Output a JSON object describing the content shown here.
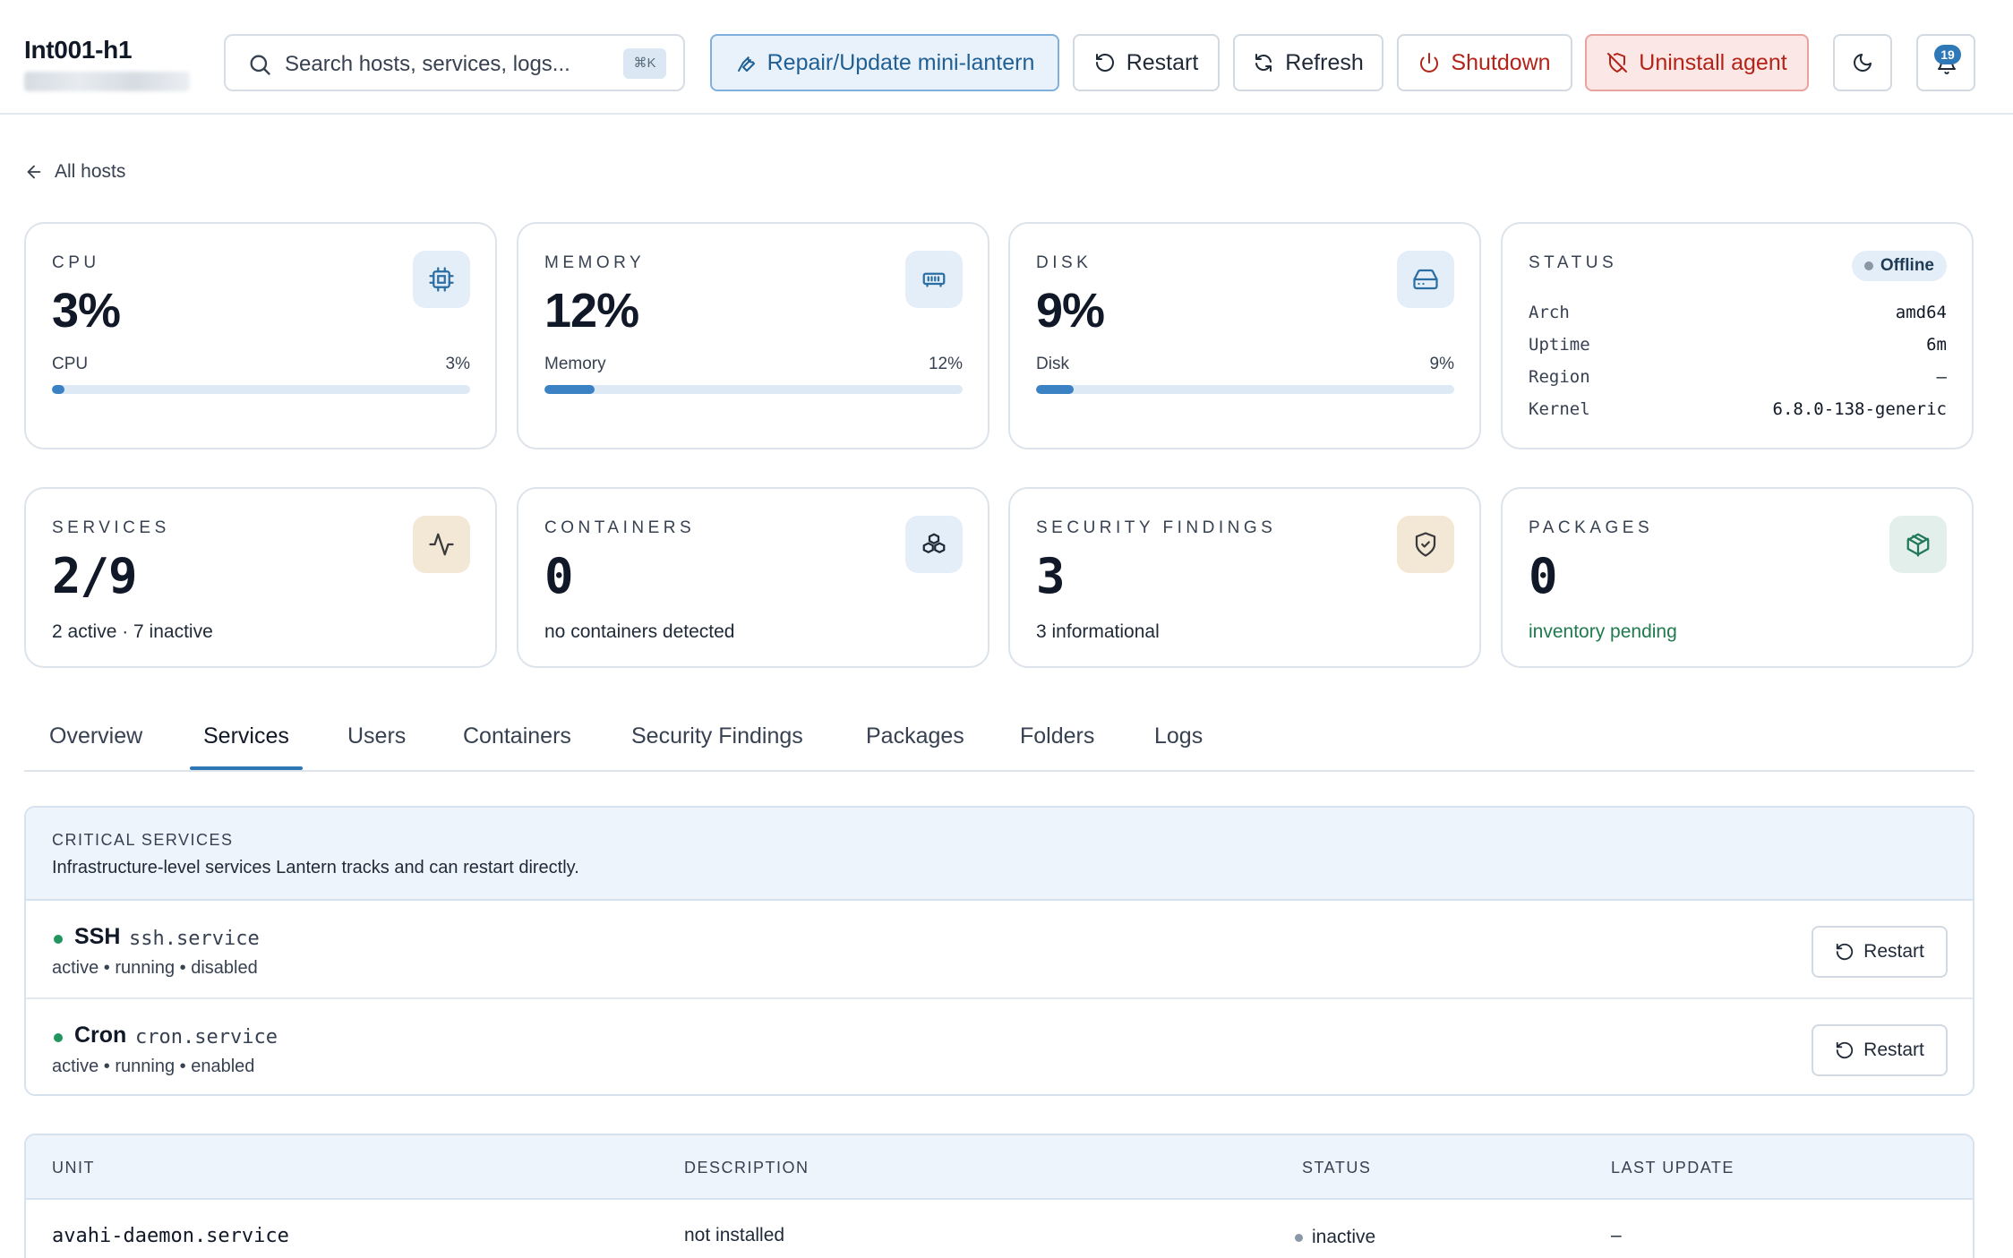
{
  "header": {
    "host_name": "Int001-h1",
    "search_placeholder": "Search hosts, services, logs...",
    "search_shortcut": "⌘K",
    "buttons": {
      "repair": "Repair/Update mini-lantern",
      "restart": "Restart",
      "refresh": "Refresh",
      "shutdown": "Shutdown",
      "uninstall": "Uninstall agent"
    },
    "notification_count": "19"
  },
  "nav": {
    "back_label": "All hosts"
  },
  "cards": {
    "cpu": {
      "label": "CPU",
      "value": "3%",
      "meter_label": "CPU",
      "meter_value": "3%",
      "percent": 3
    },
    "memory": {
      "label": "MEMORY",
      "value": "12%",
      "meter_label": "Memory",
      "meter_value": "12%",
      "percent": 12
    },
    "disk": {
      "label": "DISK",
      "value": "9%",
      "meter_label": "Disk",
      "meter_value": "9%",
      "percent": 9
    },
    "status": {
      "label": "STATUS",
      "badge": "Offline",
      "rows": [
        {
          "key": "Arch",
          "value": "amd64"
        },
        {
          "key": "Uptime",
          "value": "6m"
        },
        {
          "key": "Region",
          "value": "–"
        },
        {
          "key": "Kernel",
          "value": "6.8.0-138-generic"
        }
      ]
    },
    "services": {
      "label": "SERVICES",
      "value": "2/9",
      "sub": "2 active · 7 inactive"
    },
    "containers": {
      "label": "CONTAINERS",
      "value": "0",
      "sub": "no containers detected"
    },
    "security": {
      "label": "SECURITY FINDINGS",
      "value": "3",
      "sub": "3 informational"
    },
    "packages": {
      "label": "PACKAGES",
      "value": "0",
      "sub": "inventory pending"
    }
  },
  "tabs": [
    "Overview",
    "Services",
    "Users",
    "Containers",
    "Security Findings",
    "Packages",
    "Folders",
    "Logs"
  ],
  "active_tab": "Services",
  "critical": {
    "title": "CRITICAL SERVICES",
    "description": "Infrastructure-level services Lantern tracks and can restart directly.",
    "services": [
      {
        "name": "SSH",
        "unit": "ssh.service",
        "state": "active • running • disabled",
        "button": "Restart"
      },
      {
        "name": "Cron",
        "unit": "cron.service",
        "state": "active • running • enabled",
        "button": "Restart"
      }
    ]
  },
  "units_table": {
    "columns": [
      "UNIT",
      "DESCRIPTION",
      "STATUS",
      "LAST UPDATE"
    ],
    "rows": [
      {
        "unit": "avahi-daemon.service",
        "description": "not installed",
        "status": "inactive",
        "last_update": "–"
      }
    ]
  },
  "colors": {
    "accent": "#2f78b7",
    "danger": "#b42318",
    "success": "#22955f",
    "meter_fill": "#3b82c4"
  },
  "icons": {
    "search": "search-icon",
    "repair": "wrench-icon",
    "restart": "rotate-ccw-icon",
    "refresh": "refresh-icon",
    "shutdown": "power-icon",
    "uninstall": "shield-off-icon",
    "theme": "moon-icon",
    "notifications": "bell-icon",
    "cpu": "chip-icon",
    "memory": "memory-icon",
    "disk": "hard-drive-icon",
    "services": "activity-icon",
    "containers": "boxes-icon",
    "security": "shield-check-icon",
    "packages": "package-icon"
  }
}
